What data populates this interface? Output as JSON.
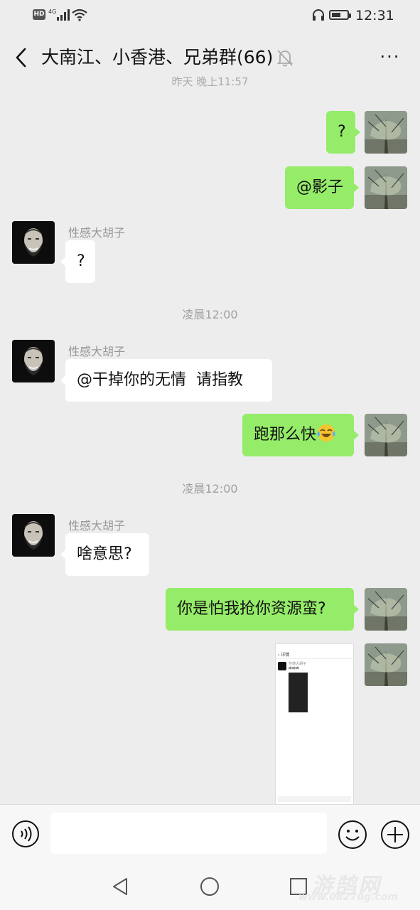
{
  "status_bar": {
    "hd": "HD",
    "network": "4G",
    "time": "12:31"
  },
  "header": {
    "title": "大南江、小香港、兄弟群(66)",
    "more": "···"
  },
  "partial_time": "昨天 晚上11:57",
  "messages": [
    {
      "text": "?"
    },
    {
      "text": "@影子"
    },
    {
      "sender": "性感大胡子",
      "text": "?"
    },
    {
      "time": "凌晨12:00"
    },
    {
      "sender": "性感大胡子",
      "text": "@干掉你的无情  请指教"
    },
    {
      "text": "跑那么快"
    },
    {
      "time": "凌晨12:00"
    },
    {
      "sender": "性感大胡子",
      "text": "啥意思?"
    },
    {
      "text": "你是怕我抢你资源蛮?"
    }
  ],
  "thumbnail": {
    "top": "详情",
    "name": "性感大胡子",
    "line": "哔哔哔"
  },
  "watermark": {
    "main": "游鹄网",
    "url": "www.0827ug.com"
  },
  "colors": {
    "bg": "#ededed",
    "me_bubble": "#95ec69",
    "other_bubble": "#ffffff"
  }
}
